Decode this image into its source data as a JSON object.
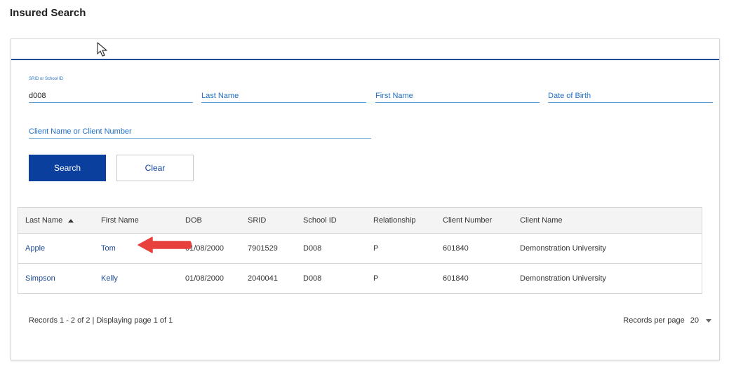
{
  "page": {
    "title": "Insured Search"
  },
  "form": {
    "srid": {
      "label": "SRID or School ID",
      "value": "d008"
    },
    "last_name": {
      "placeholder": "Last Name"
    },
    "first_name": {
      "placeholder": "First Name"
    },
    "dob": {
      "placeholder": "Date of Birth"
    },
    "client": {
      "placeholder": "Client Name or Client Number"
    },
    "search_label": "Search",
    "clear_label": "Clear"
  },
  "table": {
    "columns": [
      "Last Name",
      "First Name",
      "DOB",
      "SRID",
      "School ID",
      "Relationship",
      "Client Number",
      "Client Name"
    ],
    "rows": [
      [
        "Apple",
        "Tom",
        "01/08/2000",
        "7901529",
        "D008",
        "P",
        "601840",
        "Demonstration University"
      ],
      [
        "Simpson",
        "Kelly",
        "01/08/2000",
        "2040041",
        "D008",
        "P",
        "601840",
        "Demonstration University"
      ]
    ]
  },
  "footer": {
    "records_info": "Records 1 - 2 of 2 | Displaying page 1 of 1",
    "records_per_page_label": "Records per page",
    "records_per_page_value": "20"
  },
  "colors": {
    "accent": "#0b3f9e",
    "link": "#1f4c96",
    "field_underline": "#5aa0d8",
    "annotation_arrow": "#e8403c"
  },
  "icons": {
    "sort": "sort-ascending-icon",
    "cursor": "mouse-pointer-icon",
    "dropdown": "chevron-down-icon",
    "annotation": "red-arrow-icon"
  }
}
